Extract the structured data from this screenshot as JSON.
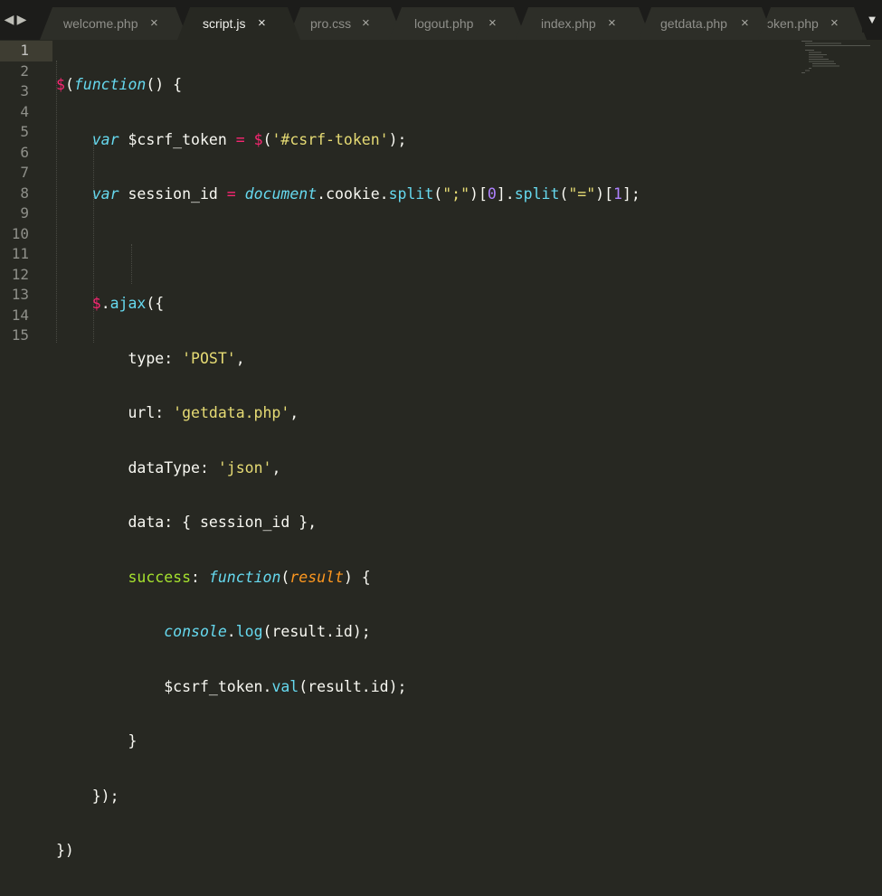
{
  "tabs": [
    {
      "label": "welcome.php",
      "close": "×",
      "active": false
    },
    {
      "label": "script.js",
      "close": "×",
      "active": true
    },
    {
      "label": "pro.css",
      "close": "×",
      "active": false
    },
    {
      "label": "logout.php",
      "close": "×",
      "active": false
    },
    {
      "label": "index.php",
      "close": "×",
      "active": false
    },
    {
      "label": "getdata.php",
      "close": "×",
      "active": false
    },
    {
      "label": "ɔken.php",
      "close": "×",
      "active": false
    }
  ],
  "nav": {
    "prev": "◀",
    "next": "▶",
    "dropdown": "▼"
  },
  "editor": {
    "current_line": 1,
    "line_numbers": [
      "1",
      "2",
      "3",
      "4",
      "5",
      "6",
      "7",
      "8",
      "9",
      "10",
      "11",
      "12",
      "13",
      "14",
      "15"
    ],
    "code": {
      "l1": {
        "a": "$",
        "b": "(",
        "c": "function",
        "d": "() {"
      },
      "l2": {
        "a": "var",
        "b": " $csrf_token ",
        "c": "=",
        "d": " ",
        "e": "$",
        "f": "(",
        "g": "'#csrf-token'",
        "h": ");"
      },
      "l3": {
        "a": "var",
        "b": " session_id ",
        "c": "=",
        "d": " ",
        "e": "document",
        "f": ".cookie.",
        "g": "split",
        "h": "(",
        "i": "\";\"",
        "j": ")[",
        "k": "0",
        "l": "].",
        "m": "split",
        "n": "(",
        "o": "\"=\"",
        "p": ")[",
        "q": "1",
        "r": "];"
      },
      "l5": {
        "a": "$",
        "b": ".",
        "c": "ajax",
        "d": "({"
      },
      "l6": {
        "a": "type: ",
        "b": "'POST'",
        "c": ","
      },
      "l7": {
        "a": "url: ",
        "b": "'getdata.php'",
        "c": ","
      },
      "l8": {
        "a": "dataType: ",
        "b": "'json'",
        "c": ","
      },
      "l9": {
        "a": "data: { session_id },"
      },
      "l10": {
        "a": "success",
        "b": ": ",
        "c": "function",
        "d": "(",
        "e": "result",
        "f": ") {"
      },
      "l11": {
        "a": "console",
        "b": ".",
        "c": "log",
        "d": "(result.id);"
      },
      "l12": {
        "a": "$csrf_token.",
        "b": "val",
        "c": "(result.id);"
      },
      "l13": {
        "a": "}"
      },
      "l14": {
        "a": "});"
      },
      "l15": {
        "a": "})"
      }
    }
  },
  "colors": {
    "background": "#272822",
    "tabbar": "#1c1c1a",
    "keyword": "#f92672",
    "storage": "#66d9ef",
    "string": "#e6db74",
    "function": "#a6e22e",
    "parameter": "#fd971f",
    "number": "#ae81ff"
  }
}
